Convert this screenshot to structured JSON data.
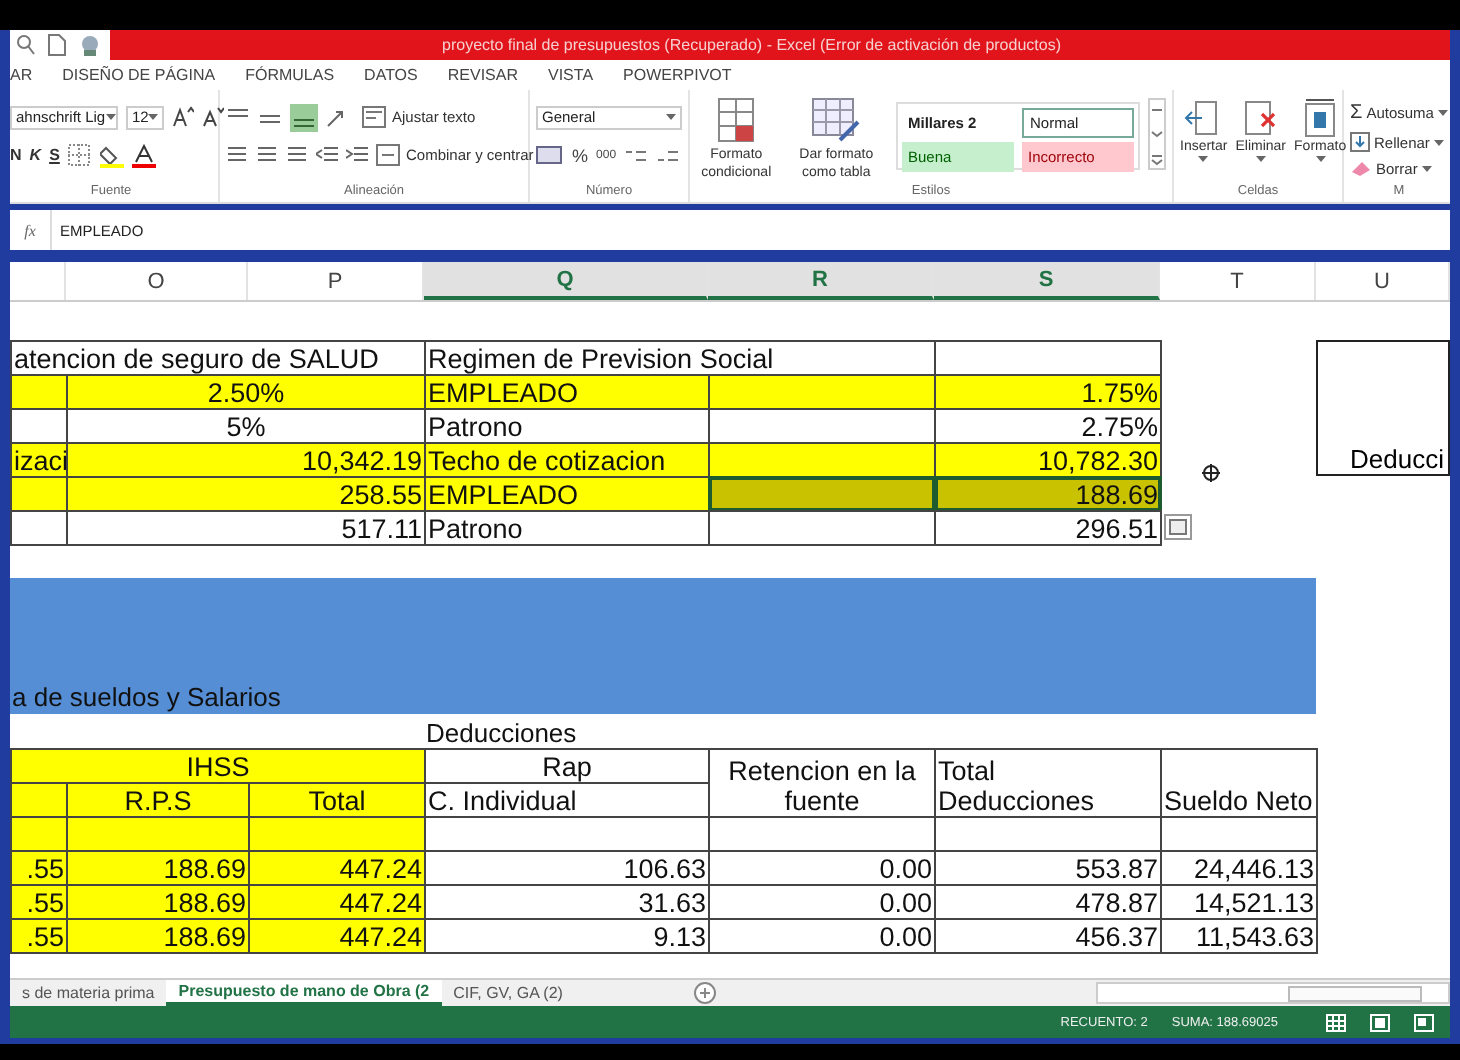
{
  "window": {
    "title": "proyecto final de presupuestos (Recuperado) - Excel (Error de activación de productos)"
  },
  "ribbon_tabs": [
    "AR",
    "DISEÑO DE PÁGINA",
    "FÓRMULAS",
    "DATOS",
    "REVISAR",
    "VISTA",
    "POWERPIVOT"
  ],
  "ribbon": {
    "font": {
      "font_name": "ahnschrift Lig",
      "font_size": "12",
      "style_buttons": [
        "N",
        "K",
        "S"
      ],
      "label": "Fuente"
    },
    "alignment": {
      "wrap": "Ajustar texto",
      "merge": "Combinar y centrar",
      "label": "Alineación"
    },
    "number": {
      "format": "General",
      "percent": "%",
      "thousands": "000",
      "label": "Número"
    },
    "styles": {
      "conditional": "Formato condicional",
      "as_table": "Dar formato como tabla",
      "label": "Estilos",
      "gallery": [
        {
          "label": "Millares 2",
          "kind": "plain"
        },
        {
          "label": "Normal",
          "kind": "normal"
        },
        {
          "label": "Buena",
          "kind": "good"
        },
        {
          "label": "Incorrecto",
          "kind": "bad"
        }
      ]
    },
    "cells": {
      "buttons": [
        "Insertar",
        "Eliminar",
        "Formato"
      ],
      "label": "Celdas"
    },
    "editing": {
      "sum_symbol": "Σ",
      "buttons": [
        "Autosuma",
        "Rellenar",
        "Borrar"
      ],
      "label": "M"
    }
  },
  "formula_bar": {
    "function_symbol": "fx",
    "content": "EMPLEADO"
  },
  "columns": [
    {
      "selected": false
    },
    {
      "label": "O",
      "selected": false
    },
    {
      "label": "P",
      "selected": false
    },
    {
      "label": "Q",
      "selected": true
    },
    {
      "label": "R",
      "selected": true
    },
    {
      "label": "S",
      "selected": true
    },
    {
      "label": "T",
      "selected": false
    },
    {
      "label": "U",
      "selected": false
    }
  ],
  "upper_table": {
    "rows": [
      [
        {
          "text": "atencion de seguro de SALUD",
          "kind": "text",
          "selected": false
        },
        {
          "text": "",
          "kind": "joined"
        },
        {
          "text": "",
          "kind": "joined"
        },
        {
          "text": "Regimen de Prevision Social",
          "kind": "text",
          "selected": false
        },
        {
          "text": "",
          "kind": "joined"
        },
        {
          "text": "",
          "kind": "text",
          "selected": false
        }
      ],
      [
        {
          "text": "",
          "kind": "text",
          "color": "#ffff00",
          "selected": false
        },
        {
          "text": "2.50%",
          "kind": "center",
          "color": "#ffff00",
          "selected": false
        },
        {
          "text": "",
          "kind": "joined"
        },
        {
          "text": "EMPLEADO",
          "kind": "text",
          "color": "#ffff00",
          "selected": false
        },
        {
          "text": "",
          "kind": "text",
          "color": "#ffff00",
          "selected": false
        },
        {
          "text": "1.75%",
          "kind": "number",
          "color": "#ffff00",
          "selected": false
        }
      ],
      [
        {
          "text": "",
          "kind": "text",
          "selected": false
        },
        {
          "text": "5%",
          "kind": "center",
          "selected": false
        },
        {
          "text": "",
          "kind": "joined"
        },
        {
          "text": "Patrono",
          "kind": "text",
          "selected": false
        },
        {
          "text": "",
          "kind": "text",
          "selected": false
        },
        {
          "text": "2.75%",
          "kind": "number",
          "selected": false
        }
      ],
      [
        {
          "text": "izaci",
          "kind": "text",
          "color": "#ffff00",
          "selected": false
        },
        {
          "text": "10,342.19",
          "kind": "number",
          "color": "#ffff00",
          "selected": false
        },
        {
          "text": "",
          "kind": "joined"
        },
        {
          "text": "Techo de cotizacion",
          "kind": "text",
          "color": "#ffff00",
          "selected": false
        },
        {
          "text": "",
          "kind": "text",
          "color": "#ffff00",
          "selected": false
        },
        {
          "text": "10,782.30",
          "kind": "number",
          "color": "#ffff00",
          "selected": false
        }
      ],
      [
        {
          "text": "",
          "kind": "text",
          "color": "#ffff00",
          "selected": false
        },
        {
          "text": "258.55",
          "kind": "number",
          "color": "#ffff00",
          "selected": false
        },
        {
          "text": "",
          "kind": "joined"
        },
        {
          "text": "EMPLEADO",
          "kind": "text",
          "color": "#ffff00",
          "selected": false
        },
        {
          "text": "",
          "kind": "text",
          "color": "#c8c200",
          "selected": true
        },
        {
          "text": "188.69",
          "kind": "number",
          "color": "#c8c200",
          "selected": true
        }
      ],
      [
        {
          "text": "",
          "kind": "text",
          "selected": false
        },
        {
          "text": "517.11",
          "kind": "number",
          "selected": false
        },
        {
          "text": "",
          "kind": "joined"
        },
        {
          "text": "Patrono",
          "kind": "text",
          "selected": false
        },
        {
          "text": "",
          "kind": "text",
          "selected": false
        },
        {
          "text": "296.51",
          "kind": "number",
          "selected": false
        }
      ]
    ],
    "side_box": "Deducci"
  },
  "banner": {
    "text": "a de sueldos y Salarios"
  },
  "lower_table": {
    "caption": "Deducciones",
    "rows": [
      [
        {
          "text": "",
          "kind": "lead"
        },
        {
          "text": "IHSS",
          "kind": "center",
          "color": "#ffff00",
          "selected": false
        },
        {
          "text": "",
          "kind": "joined"
        },
        {
          "text": "Rap",
          "kind": "center",
          "selected": false
        },
        {
          "text": "Retencion en la fuente",
          "kind": "center",
          "selected": false
        },
        {
          "text": "Total Deducciones",
          "kind": "text",
          "selected": false
        },
        {
          "text": "Sueldo Neto",
          "kind": "text",
          "selected": false
        }
      ],
      [
        {
          "text": "",
          "kind": "text",
          "color": "#ffff00",
          "selected": false
        },
        {
          "text": "R.P.S",
          "kind": "center",
          "color": "#ffff00",
          "selected": false
        },
        {
          "text": "Total",
          "kind": "center",
          "color": "#ffff00",
          "selected": false
        },
        {
          "text": "C. Individual",
          "kind": "text",
          "selected": false
        },
        {
          "text": "",
          "kind": "covered"
        },
        {
          "text": "",
          "kind": "covered"
        },
        {
          "text": "",
          "kind": "covered"
        }
      ],
      [
        {
          "text": "",
          "kind": "text",
          "color": "#ffff00",
          "selected": false
        },
        {
          "text": "",
          "kind": "text",
          "color": "#ffff00",
          "selected": false
        },
        {
          "text": "",
          "kind": "text",
          "color": "#ffff00",
          "selected": false
        },
        {
          "text": "",
          "kind": "text",
          "selected": false
        },
        {
          "text": "",
          "kind": "text",
          "selected": false
        },
        {
          "text": "",
          "kind": "text",
          "selected": false
        },
        {
          "text": "",
          "kind": "text",
          "selected": false
        }
      ],
      [
        {
          "text": ".55",
          "kind": "number",
          "color": "#ffff00",
          "selected": false
        },
        {
          "text": "188.69",
          "kind": "number",
          "color": "#ffff00",
          "selected": false
        },
        {
          "text": "447.24",
          "kind": "number",
          "color": "#ffff00",
          "selected": false
        },
        {
          "text": "106.63",
          "kind": "number",
          "selected": false
        },
        {
          "text": "0.00",
          "kind": "number",
          "selected": false
        },
        {
          "text": "553.87",
          "kind": "number",
          "selected": false
        },
        {
          "text": "24,446.13",
          "kind": "number",
          "selected": false
        }
      ],
      [
        {
          "text": ".55",
          "kind": "number",
          "color": "#ffff00",
          "selected": false
        },
        {
          "text": "188.69",
          "kind": "number",
          "color": "#ffff00",
          "selected": false
        },
        {
          "text": "447.24",
          "kind": "number",
          "color": "#ffff00",
          "selected": false
        },
        {
          "text": "31.63",
          "kind": "number",
          "selected": false
        },
        {
          "text": "0.00",
          "kind": "number",
          "selected": false
        },
        {
          "text": "478.87",
          "kind": "number",
          "selected": false
        },
        {
          "text": "14,521.13",
          "kind": "number",
          "selected": false
        }
      ],
      [
        {
          "text": ".55",
          "kind": "number",
          "color": "#ffff00",
          "selected": false
        },
        {
          "text": "188.69",
          "kind": "number",
          "color": "#ffff00",
          "selected": false
        },
        {
          "text": "447.24",
          "kind": "number",
          "color": "#ffff00",
          "selected": false
        },
        {
          "text": "9.13",
          "kind": "number",
          "selected": false
        },
        {
          "text": "0.00",
          "kind": "number",
          "selected": false
        },
        {
          "text": "456.37",
          "kind": "number",
          "selected": false
        },
        {
          "text": "11,543.63",
          "kind": "number",
          "selected": false
        }
      ]
    ]
  },
  "sheet_tabs": [
    {
      "label": "s de materia prima",
      "selected": false
    },
    {
      "label": "Presupuesto de mano de Obra (2",
      "selected": true
    },
    {
      "label": "CIF, GV, GA (2)",
      "selected": false
    }
  ],
  "status_bar": {
    "count": "RECUENTO: 2",
    "sum": "SUMA: 188.69025"
  }
}
